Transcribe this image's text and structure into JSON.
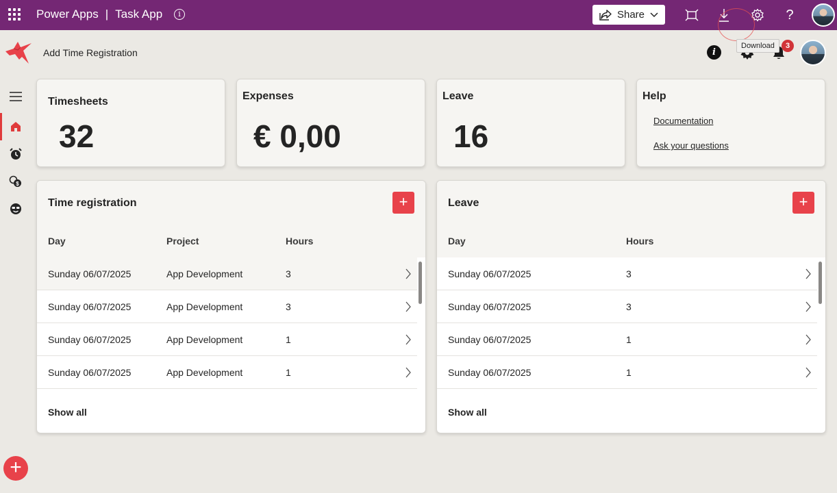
{
  "topbar": {
    "product": "Power Apps",
    "separator": "|",
    "app_name": "Task App",
    "share_label": "Share",
    "icons": [
      "waffle-icon",
      "info-icon",
      "share-icon",
      "fit-screen-icon",
      "download-icon",
      "gear-icon",
      "help-icon"
    ],
    "bg_color": "#742774"
  },
  "header": {
    "title": "Add Time Registration",
    "info_glyph": "i",
    "notification_count": "3",
    "tooltip": "Download"
  },
  "nav": {
    "items": [
      "menu",
      "home",
      "timer",
      "expenses",
      "leave"
    ],
    "active": "home",
    "accent_color": "#e03c3c"
  },
  "stats": {
    "timesheets": {
      "title": "Timesheets",
      "value": "32"
    },
    "expenses": {
      "title": "Expenses",
      "value": "€ 0,00"
    },
    "leave": {
      "title": "Leave",
      "value": "16"
    },
    "help": {
      "title": "Help",
      "links": [
        "Documentation",
        "Ask your questions"
      ]
    }
  },
  "time_registration": {
    "title": "Time registration",
    "add_glyph": "+",
    "columns": [
      "Day",
      "Project",
      "Hours"
    ],
    "rows": [
      {
        "day": "Sunday 06/07/2025",
        "project": "App Development",
        "hours": "3"
      },
      {
        "day": "Sunday 06/07/2025",
        "project": "App Development",
        "hours": "3"
      },
      {
        "day": "Sunday 06/07/2025",
        "project": "App Development",
        "hours": "1"
      },
      {
        "day": "Sunday 06/07/2025",
        "project": "App Development",
        "hours": "1"
      }
    ],
    "show_all": "Show all"
  },
  "leave_panel": {
    "title": "Leave",
    "add_glyph": "+",
    "columns": [
      "Day",
      "Hours"
    ],
    "rows": [
      {
        "day": "Sunday 06/07/2025",
        "hours": "3"
      },
      {
        "day": "Sunday 06/07/2025",
        "hours": "3"
      },
      {
        "day": "Sunday 06/07/2025",
        "hours": "1"
      },
      {
        "day": "Sunday 06/07/2025",
        "hours": "1"
      }
    ],
    "show_all": "Show all"
  },
  "fab_glyph": "+",
  "colors": {
    "accent_red": "#e8424a",
    "page_bg": "#ebe9e4"
  }
}
